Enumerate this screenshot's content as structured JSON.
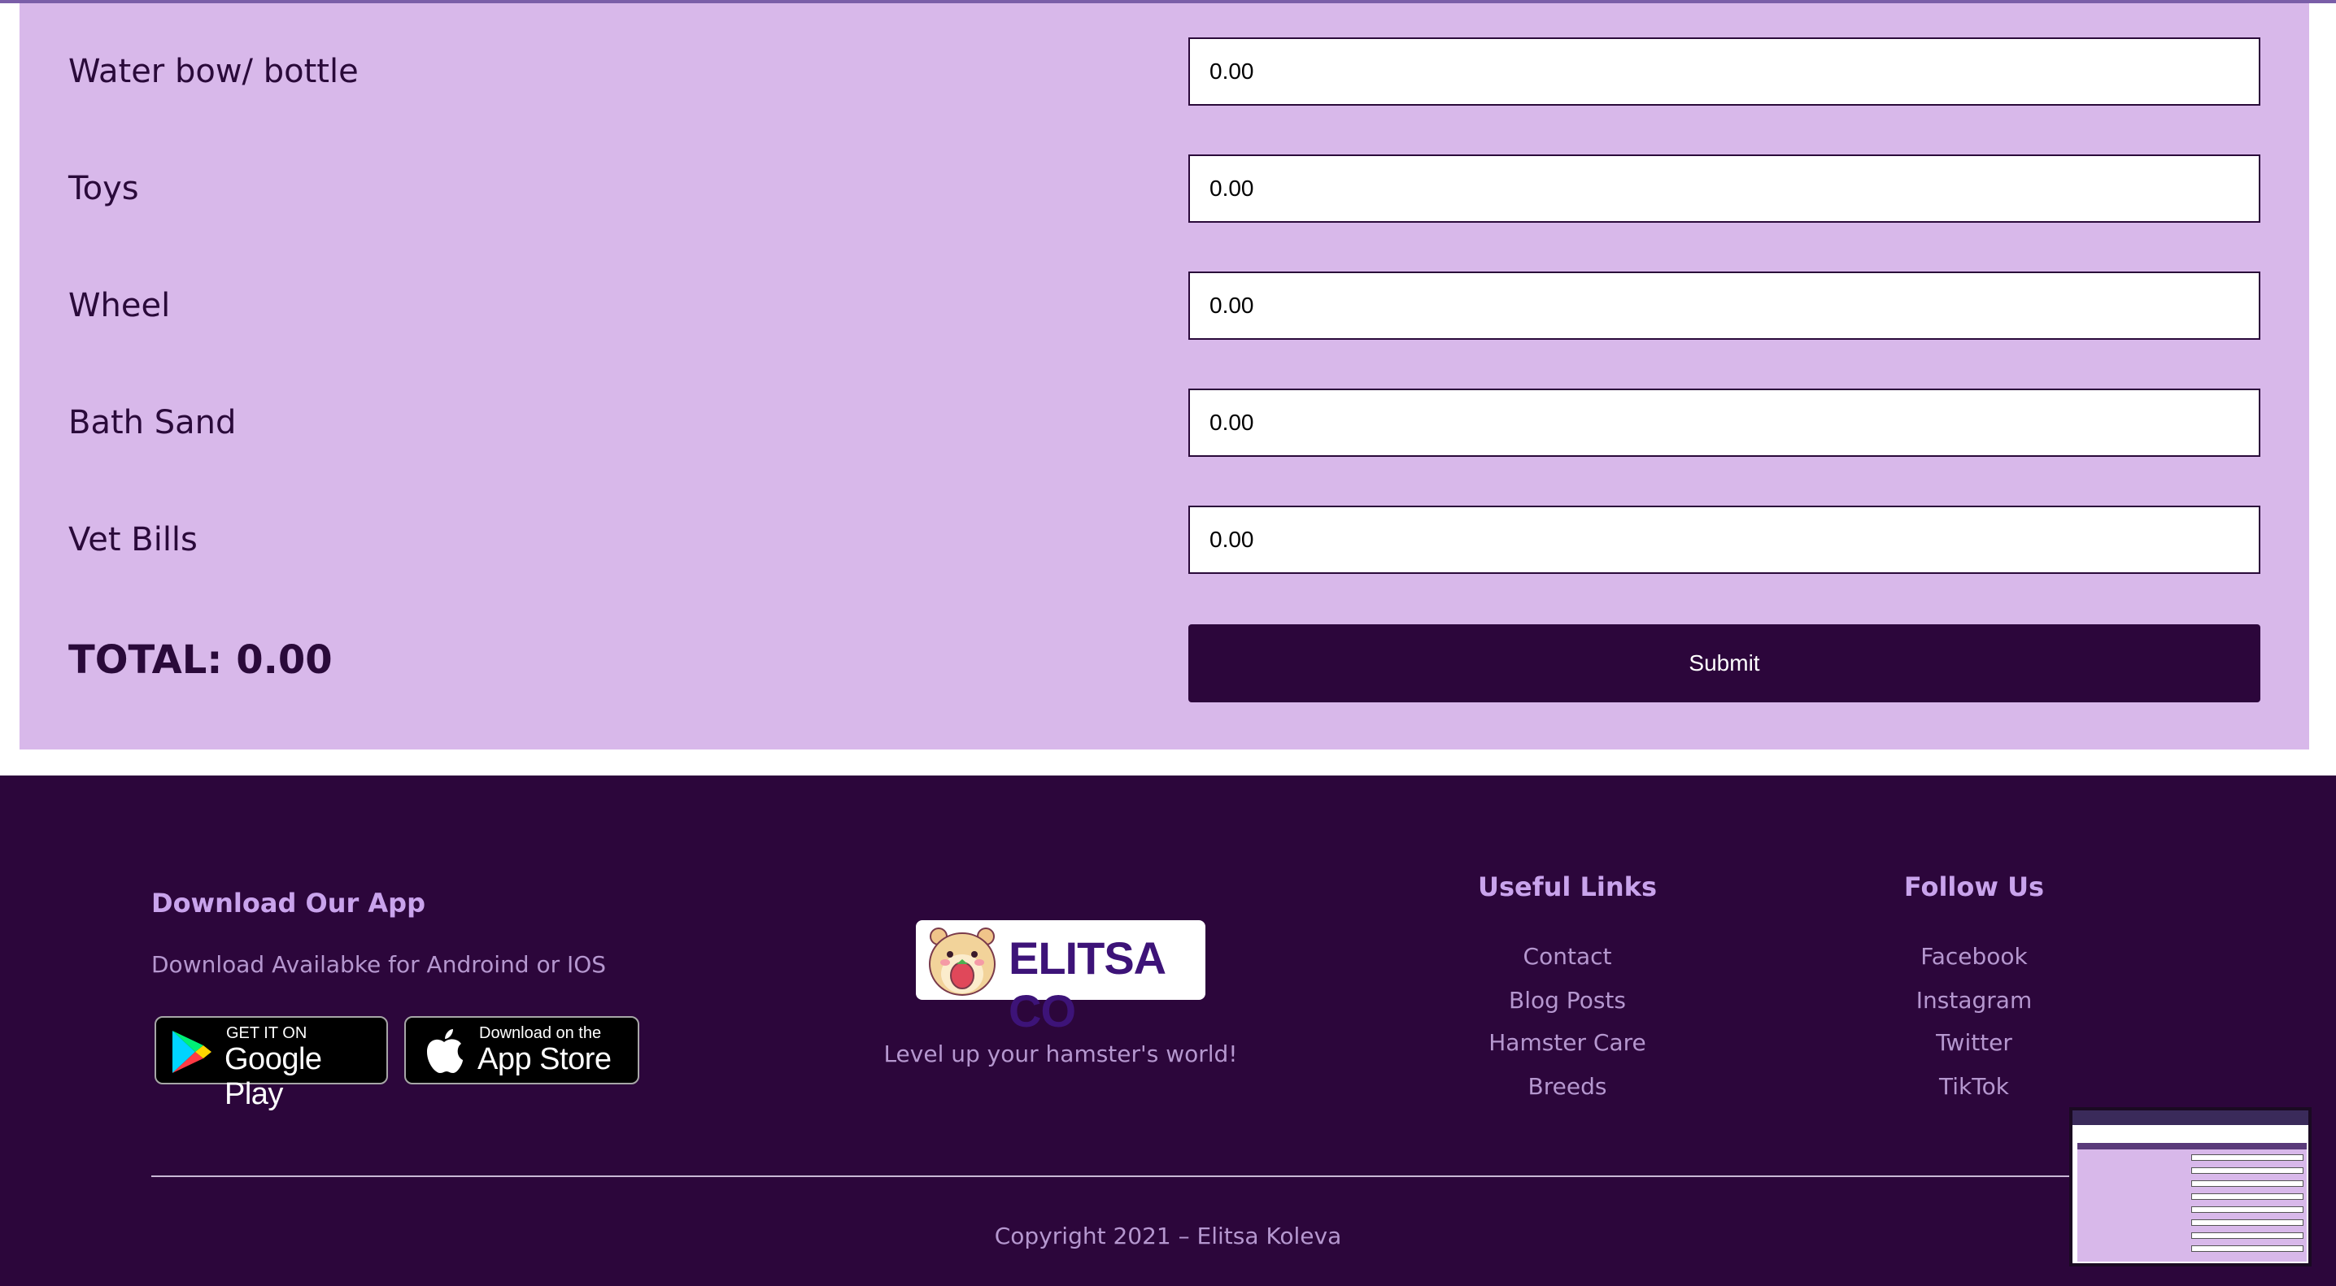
{
  "form": {
    "rows": [
      {
        "label": "Water bow/ bottle",
        "value": "0.00"
      },
      {
        "label": "Toys",
        "value": "0.00"
      },
      {
        "label": "Wheel",
        "value": "0.00"
      },
      {
        "label": "Bath Sand",
        "value": "0.00"
      },
      {
        "label": "Vet Bills",
        "value": "0.00"
      }
    ],
    "total_label": "TOTAL: 0.00",
    "submit_label": "Submit"
  },
  "footer": {
    "app": {
      "heading": "Download Our App",
      "text": "Download Availabke for Androind or IOS",
      "google_play": {
        "small": "GET IT ON",
        "big": "Google Play"
      },
      "app_store": {
        "small": "Download on the",
        "big": "App Store"
      }
    },
    "brand": {
      "logo_text": "ELITSA CO",
      "tagline": "Level up your hamster's world!"
    },
    "useful_links": {
      "heading": "Useful Links",
      "items": [
        "Contact",
        "Blog Posts",
        "Hamster Care",
        "Breeds"
      ]
    },
    "follow_us": {
      "heading": "Follow Us",
      "items": [
        "Facebook",
        "Instagram",
        "Twitter",
        "TikTok"
      ]
    },
    "copyright": "Copyright 2021 – Elitsa Koleva"
  },
  "colors": {
    "panel": "#d8b8ea",
    "footer": "#2c063b",
    "accent": "#c9a3ec"
  }
}
